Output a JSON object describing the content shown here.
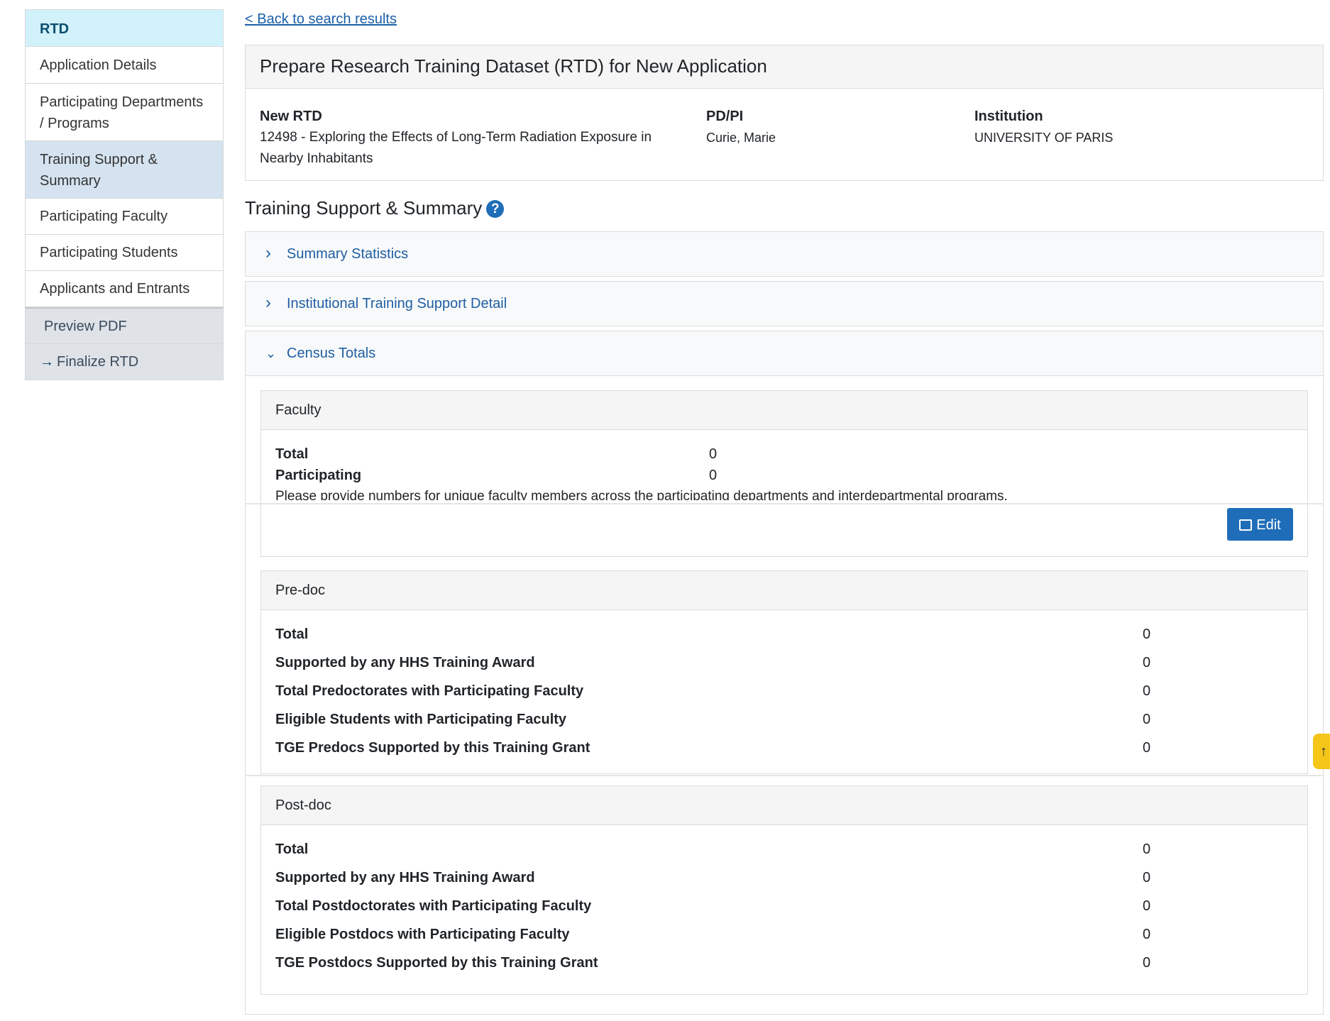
{
  "sidebar": {
    "header": "RTD",
    "items": [
      {
        "label": "Application Details"
      },
      {
        "label": "Participating Departments / Programs"
      },
      {
        "label": "Training Support & Summary"
      },
      {
        "label": "Participating Faculty"
      },
      {
        "label": "Participating Students"
      },
      {
        "label": "Applicants and Entrants"
      }
    ],
    "actions": [
      {
        "label": "Preview PDF"
      },
      {
        "label": "Finalize RTD"
      }
    ]
  },
  "back_link": "< Back to search results",
  "application": {
    "header": "Prepare Research Training Dataset (RTD) for New Application",
    "rtd_label": "New RTD",
    "rtd_value": "12498 - Exploring the Effects of Long-Term Radiation Exposure in Nearby Inhabitants",
    "pdpi_label": "PD/PI",
    "pdpi_value": "Curie, Marie",
    "institution_label": "Institution",
    "institution_value": "UNIVERSITY OF PARIS"
  },
  "section_title": "Training Support & Summary",
  "accordions": {
    "summary_statistics": "Summary Statistics",
    "institutional_support": "Institutional Training Support Detail",
    "census_totals": "Census Totals"
  },
  "faculty": {
    "title": "Faculty",
    "total_label": "Total",
    "total_value": "0",
    "participating_label": "Participating",
    "participating_value": "0",
    "note": "Please provide numbers for unique faculty members across the participating departments and interdepartmental programs.",
    "edit_label": "Edit"
  },
  "predoc": {
    "title": "Pre-doc",
    "rows": [
      {
        "label": "Total",
        "value": "0"
      },
      {
        "label": "Supported by any HHS Training Award",
        "value": "0"
      },
      {
        "label": "Total Predoctorates with Participating Faculty",
        "value": "0"
      },
      {
        "label": "Eligible Students with Participating Faculty",
        "value": "0"
      },
      {
        "label": "TGE Predocs Supported by this Training Grant",
        "value": "0"
      }
    ]
  },
  "postdoc": {
    "title": "Post-doc",
    "rows": [
      {
        "label": "Total",
        "value": "0"
      },
      {
        "label": "Supported by any HHS Training Award",
        "value": "0"
      },
      {
        "label": "Total Postdoctorates with Participating Faculty",
        "value": "0"
      },
      {
        "label": "Eligible Postdocs with Participating Faculty",
        "value": "0"
      },
      {
        "label": "TGE Postdocs Supported by this Training Grant",
        "value": "0"
      }
    ]
  },
  "icons": {
    "help": "question-circle-icon",
    "edit": "edit-icon",
    "arrow": "arrow-right-icon",
    "chevron_right": "chevron-right-icon",
    "chevron_down": "chevron-down-icon",
    "scroll_top": "arrow-up-icon"
  }
}
